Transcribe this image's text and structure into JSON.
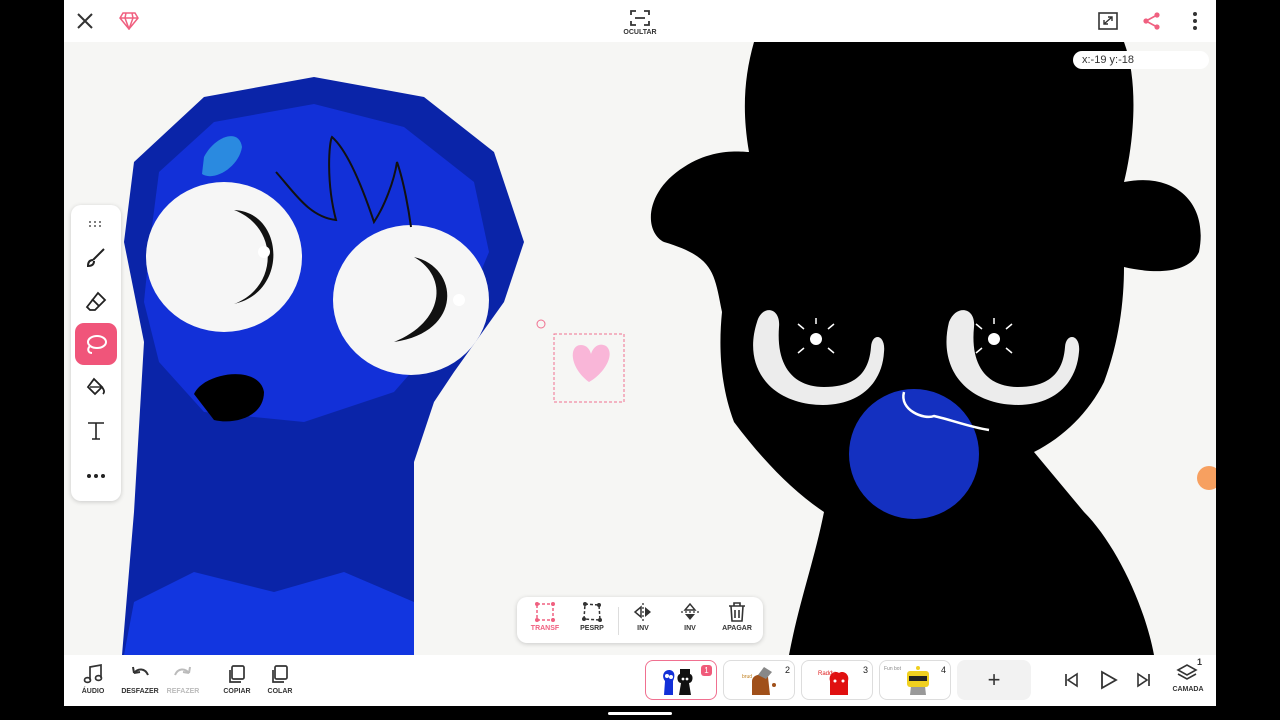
{
  "top_bar": {
    "close_icon": "close-icon",
    "premium_icon": "gem-icon",
    "hide_label": "OCULTAR",
    "fullscreen_icon": "expand-icon",
    "share_icon": "share-icon",
    "more_icon": "more-vertical-icon"
  },
  "canvas": {
    "coordinates": "x:-19 y:-18"
  },
  "side_tools": [
    {
      "name": "brush",
      "icon": "brush-icon",
      "active": false
    },
    {
      "name": "eraser",
      "icon": "eraser-icon",
      "active": false
    },
    {
      "name": "lasso",
      "icon": "lasso-icon",
      "active": true
    },
    {
      "name": "fill",
      "icon": "fill-bucket-icon",
      "active": false
    },
    {
      "name": "text",
      "icon": "text-icon",
      "active": false
    },
    {
      "name": "more",
      "icon": "more-horizontal-icon",
      "active": false
    }
  ],
  "selection_toolbar": {
    "transform": "TRANSF",
    "perspective": "PESRP",
    "flip_h": "INV",
    "flip_v": "INV",
    "delete": "APAGAR"
  },
  "bottom_bar": {
    "audio": "ÁUDIO",
    "undo": "DESFAZER",
    "redo": "REFAZER",
    "copy": "COPIAR",
    "paste": "COLAR",
    "layer": "CAMADA",
    "layer_count": "1",
    "add_frame": "+"
  },
  "frames": [
    {
      "number": "1",
      "active": true
    },
    {
      "number": "2",
      "active": false,
      "caption": "brud"
    },
    {
      "number": "3",
      "active": false,
      "caption": "Raddy"
    },
    {
      "number": "4",
      "active": false,
      "caption": "Fun bot"
    }
  ],
  "colors": {
    "accent": "#f0557a",
    "blue_character": "#1230d8",
    "dark_character": "#000000"
  }
}
